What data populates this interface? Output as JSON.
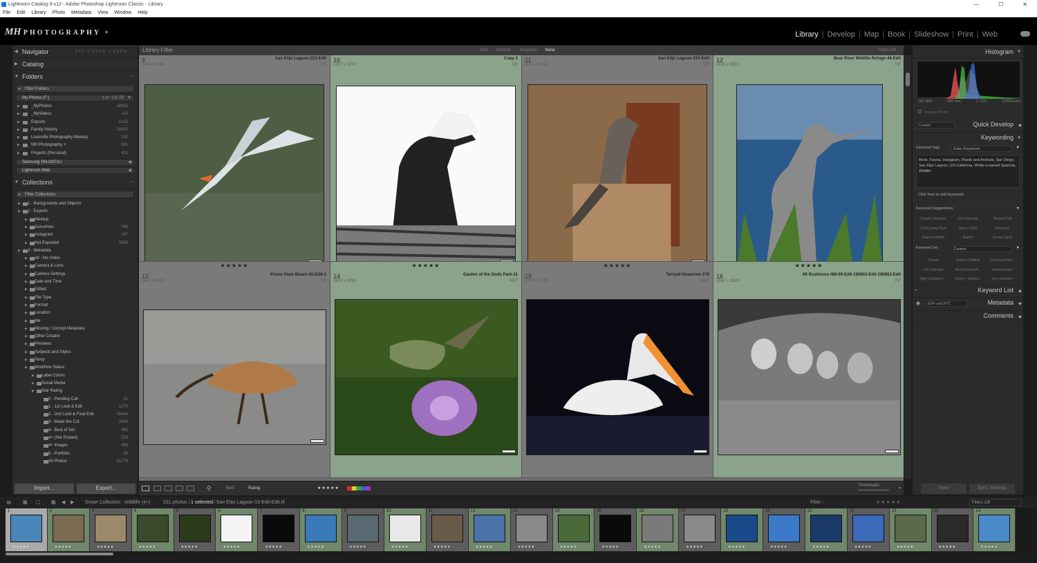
{
  "window": {
    "title": "Lightroom Catalog-3-v12 - Adobe Photoshop Lightroom Classic - Library"
  },
  "menu": [
    "File",
    "Edit",
    "Library",
    "Photo",
    "Metadata",
    "View",
    "Window",
    "Help"
  ],
  "identity": {
    "logo_text": "PHOTOGRAPHY +"
  },
  "modules": [
    "Library",
    "Develop",
    "Map",
    "Book",
    "Slideshow",
    "Print",
    "Web"
  ],
  "active_module": "Library",
  "left": {
    "navigator": {
      "title": "Navigator",
      "zoom": [
        "FIT",
        "100%",
        "200%"
      ]
    },
    "catalog": "Catalog",
    "folders": {
      "title": "Folders",
      "filter": "Filter Folders",
      "volume": {
        "name": "My Photos (F:)",
        "size": "1.8 / 1.8 TB"
      },
      "items": [
        {
          "name": "_MyPhotos",
          "count": "18001"
        },
        {
          "name": "_MyVideos",
          "count": "115"
        },
        {
          "name": "Exports",
          "count": "1253"
        },
        {
          "name": "Family History",
          "count": "19202"
        },
        {
          "name": "Louisville Photography Meetup",
          "count": "130"
        },
        {
          "name": "MH Photography +",
          "count": "381"
        },
        {
          "name": "Projects (Personal)",
          "count": "411"
        }
      ],
      "volume2": "Samsung SM-G973U",
      "volume3": "Lightroom Web"
    },
    "collections": {
      "title": "Collections",
      "filter": "Filter Collections",
      "items": [
        {
          "name": "1 - Backgrounds and Objects",
          "count": "",
          "lvl": 1
        },
        {
          "name": "2 - Exports",
          "count": "",
          "lvl": 1
        },
        {
          "name": "Meetup",
          "count": "",
          "lvl": 2
        },
        {
          "name": "Gurushots",
          "count": "746",
          "lvl": 2
        },
        {
          "name": "Instagram",
          "count": "187",
          "lvl": 2
        },
        {
          "name": "Not Exported",
          "count": "3535",
          "lvl": 2
        },
        {
          "name": "3 - Metadata",
          "count": "",
          "lvl": 1
        },
        {
          "name": "All - No Video",
          "count": "",
          "lvl": 2
        },
        {
          "name": "Camera & Lens",
          "count": "",
          "lvl": 2
        },
        {
          "name": "Camera Settings",
          "count": "",
          "lvl": 2
        },
        {
          "name": "Date and Time",
          "count": "",
          "lvl": 2
        },
        {
          "name": "Edited",
          "count": "",
          "lvl": 2
        },
        {
          "name": "File Type",
          "count": "",
          "lvl": 2
        },
        {
          "name": "Format",
          "count": "",
          "lvl": 2
        },
        {
          "name": "Location",
          "count": "",
          "lvl": 2
        },
        {
          "name": "Me",
          "count": "",
          "lvl": 2
        },
        {
          "name": "Missing / Corrupt Metadata",
          "count": "",
          "lvl": 2
        },
        {
          "name": "Other Creator",
          "count": "",
          "lvl": 2
        },
        {
          "name": "Previews",
          "count": "",
          "lvl": 2
        },
        {
          "name": "Subjects and Styles",
          "count": "",
          "lvl": 2
        },
        {
          "name": "Temp",
          "count": "",
          "lvl": 2
        },
        {
          "name": "Workflow Status",
          "count": "",
          "lvl": 2
        },
        {
          "name": "Label Colors",
          "count": "",
          "lvl": 3
        },
        {
          "name": "Social Media",
          "count": "",
          "lvl": 3
        },
        {
          "name": "Star Rating",
          "count": "",
          "lvl": 3
        },
        {
          "name": "0 - Pending Cull",
          "count": "20",
          "lvl": 4
        },
        {
          "name": "1 - 1st Look & Edit",
          "count": "1270",
          "lvl": 4
        },
        {
          "name": "2 - 2nd Look & Final Edit",
          "count": "16444",
          "lvl": 4
        },
        {
          "name": "3 - Made the Cut",
          "count": "3045",
          "lvl": 4
        },
        {
          "name": "4 - Best of Set",
          "count": "465",
          "lvl": 4
        },
        {
          "name": "4+ (Not Posted)",
          "count": "333",
          "lvl": 4
        },
        {
          "name": "4+ Images",
          "count": "499",
          "lvl": 4
        },
        {
          "name": "5 - Portfolio",
          "count": "34",
          "lvl": 4
        },
        {
          "name": "All Photos",
          "count": "21278",
          "lvl": 4
        }
      ]
    },
    "import_label": "Import...",
    "export_label": "Export..."
  },
  "filter": {
    "title": "Library Filter",
    "options": [
      "Text",
      "Attribute",
      "Metadata",
      "None"
    ],
    "selected": "None",
    "status": "Filters Off"
  },
  "grid": [
    {
      "idx": "9",
      "dims": "2464 x 2464",
      "name": "San Elijo Lagoon-223-Edit",
      "ext": "TIF",
      "green": false,
      "kind": "tern"
    },
    {
      "idx": "10",
      "dims": "1297 x 1297",
      "name": "Copy 2",
      "ext": "TIF",
      "green": true,
      "kind": "eagle"
    },
    {
      "idx": "11",
      "dims": "3041 x 3041",
      "name": "San Elijo Lagoon-150-Edit",
      "ext": "TIF",
      "green": false,
      "kind": "phoebe"
    },
    {
      "idx": "12",
      "dims": "2430 x 3037",
      "name": "Bear River Wildlife Refuge-48-Edit",
      "ext": "TIF",
      "green": true,
      "kind": "heron"
    },
    {
      "idx": "13",
      "dims": "2441 x 1816",
      "name": "Pismo State Beach-55-Edit-2",
      "ext": "TIF",
      "green": false,
      "kind": "curlew"
    },
    {
      "idx": "14",
      "dims": "2604 x 2081",
      "name": "Garden of the Gods Park-11",
      "ext": "NEF",
      "green": true,
      "kind": "hummer"
    },
    {
      "idx": "15",
      "dims": "2726 x 2179",
      "name": "Terryall Reservoir-278",
      "ext": "NEF",
      "green": false,
      "kind": "pelican"
    },
    {
      "idx": "16",
      "dims": "3560 x 2828",
      "name": "Mt Rushmore NM-69-Edit-180902-Edit-180902-Edit",
      "ext": "TIF",
      "green": true,
      "kind": "rushmore"
    }
  ],
  "stars": "★★★★★",
  "toolbar": {
    "sort_label": "Sort:",
    "sort_value": "Rating",
    "thumbs_label": "Thumbnails"
  },
  "right": {
    "histogram": {
      "title": "Histogram",
      "iso": "ISO 450",
      "focal": "260 mm",
      "aperture": "ƒ / 5.6",
      "shutter": "1/2500 sec",
      "original": "Original Photo"
    },
    "quick_develop": {
      "title": "Quick Develop",
      "preset": "Custom"
    },
    "keywording": {
      "title": "Keywording",
      "tags_label": "Keyword Tags",
      "tags_value": "Enter Keywords",
      "keywords": "Birds, Fauna, Instagram, Plants and Animals, San Diego, San Elijo Lagoon, US-California, White-crowned Sparrow, Wildlife",
      "add_hint": "Click here to add keywords",
      "suggestions_label": "Keyword Suggestions",
      "suggestions": [
        "Season Summer",
        "US-Colorado",
        "Season Fall",
        "City/County Park",
        "Nikon D500",
        "Encinitas",
        "Season-Winter",
        "Raptor",
        "Snowy Egret"
      ],
      "set_label": "Keyword Set",
      "set_value": "Custom",
      "set": [
        "Clouds",
        "Fence / Railing",
        "Cormorant Nat...",
        "US-Colorado",
        "Wind Driven W...",
        "Infrastructure",
        "High Contrast +...",
        "Goofy + Expres...",
        "Joy + Emotion"
      ]
    },
    "keyword_list": "Keyword List",
    "metadata": {
      "title": "Metadata",
      "preset": "EXIF and IPTC"
    },
    "comments": "Comments",
    "sync_label": "Sync",
    "sync_settings_label": "Sync Settings"
  },
  "filmstrip_header": {
    "collection": "Smart Collection : Wildlife (4+)",
    "count": "231 photos /",
    "selected": "1 selected",
    "path": "/ San Elijo Lagoon-15-Edit-Edit.tif",
    "filter_label": "Filter :",
    "filter_value": "Filters Off"
  },
  "filmstrip": [
    {
      "n": "1",
      "c": "#4a86b8",
      "sel": true
    },
    {
      "n": "2",
      "c": "#7a6a52"
    },
    {
      "n": "3",
      "c": "#9a8a6a"
    },
    {
      "n": "4",
      "c": "#3a4a2a"
    },
    {
      "n": "5",
      "c": "#2a3a1a"
    },
    {
      "n": "6",
      "c": "#f4f4f4"
    },
    {
      "n": "7",
      "c": "#0a0a0a"
    },
    {
      "n": "8",
      "c": "#3a7ab8"
    },
    {
      "n": "9",
      "c": "#5a6a72"
    },
    {
      "n": "10",
      "c": "#e8e8e8"
    },
    {
      "n": "11",
      "c": "#6a5a4a"
    },
    {
      "n": "12",
      "c": "#4a72a8"
    },
    {
      "n": "13",
      "c": "#8a8a8a"
    },
    {
      "n": "14",
      "c": "#4a6a3a"
    },
    {
      "n": "15",
      "c": "#0a0a0a"
    },
    {
      "n": "16",
      "c": "#7a7a7a"
    },
    {
      "n": "17",
      "c": "#8a8a8a"
    },
    {
      "n": "18",
      "c": "#1a4a8a"
    },
    {
      "n": "19",
      "c": "#3a7ac8"
    },
    {
      "n": "20",
      "c": "#1a3a6a"
    },
    {
      "n": "21",
      "c": "#3a6ab8"
    },
    {
      "n": "22",
      "c": "#5a6a4a"
    },
    {
      "n": "23",
      "c": "#2a2a2a"
    },
    {
      "n": "24",
      "c": "#4a8ac8"
    }
  ]
}
